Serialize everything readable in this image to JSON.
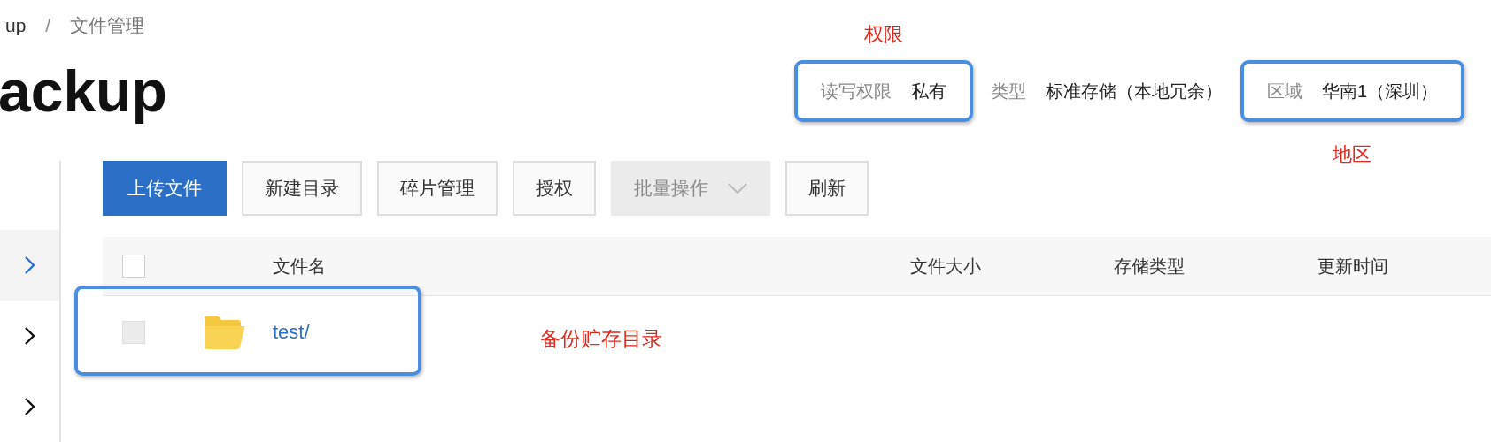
{
  "breadcrumb": {
    "items": [
      "up",
      "文件管理"
    ],
    "separator": "/"
  },
  "title": "ackup",
  "info": [
    {
      "label": "读写权限",
      "value": "私有",
      "highlighted": true,
      "note_above": "权限"
    },
    {
      "label": "类型",
      "value": "标准存储（本地冗余）"
    },
    {
      "label": "区域",
      "value": "华南1（深圳）",
      "highlighted": true,
      "note_below": "地区"
    }
  ],
  "sidebar": {
    "items": [
      {
        "selected": true
      },
      {
        "selected": false
      },
      {
        "selected": false
      }
    ]
  },
  "toolbar": [
    {
      "label": "上传文件",
      "kind": "primary",
      "disabled": false
    },
    {
      "label": "新建目录",
      "kind": "default",
      "disabled": false
    },
    {
      "label": "碎片管理",
      "kind": "default",
      "disabled": false
    },
    {
      "label": "授权",
      "kind": "default",
      "disabled": false
    },
    {
      "label": "批量操作",
      "kind": "dropdown",
      "disabled": true
    },
    {
      "label": "刷新",
      "kind": "default",
      "disabled": false
    }
  ],
  "table": {
    "select_all": {
      "checked": false
    },
    "columns": [
      "文件名",
      "文件大小",
      "存储类型",
      "更新时间"
    ],
    "rows": [
      {
        "name": "test/",
        "kind": "folder",
        "checked": false,
        "disabled": true,
        "highlighted": true,
        "note_right": "备份贮存目录"
      }
    ]
  }
}
